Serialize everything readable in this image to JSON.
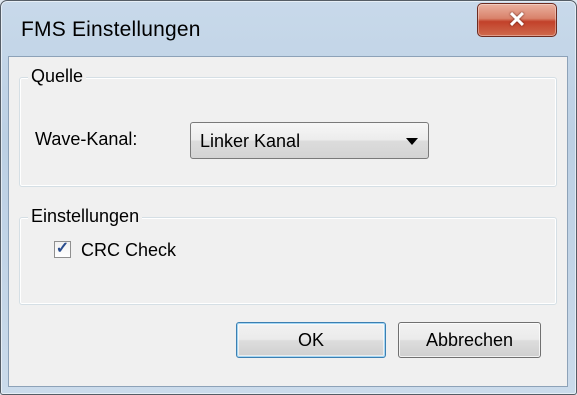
{
  "window": {
    "title": "FMS Einstellungen",
    "close_icon": "close-icon",
    "close_glyph": "✕"
  },
  "source_group": {
    "label": "Quelle",
    "wave_channel_label": "Wave-Kanal:",
    "wave_channel_value": "Linker Kanal"
  },
  "settings_group": {
    "label": "Einstellungen",
    "crc_check_label": "CRC Check",
    "crc_check_checked": true,
    "check_glyph": "✓"
  },
  "buttons": {
    "ok_label": "OK",
    "cancel_label": "Abbrechen"
  }
}
